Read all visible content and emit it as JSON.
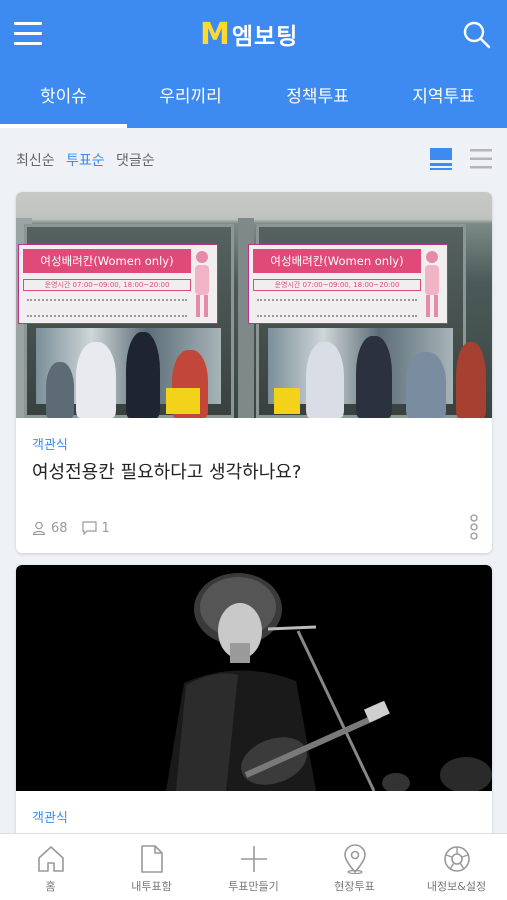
{
  "header": {
    "logo_letter": "M",
    "app_name": "엠보팅"
  },
  "tabs": [
    "핫이슈",
    "우리끼리",
    "정책투표",
    "지역투표"
  ],
  "sort_options": [
    "최신순",
    "투표순",
    "댓글순"
  ],
  "cards": [
    {
      "category": "객관식",
      "title": "여성전용칸 필요하다고 생각하나요?",
      "votes": "68",
      "comments": "1",
      "image": {
        "sign_title": "여성배려칸(Women only)",
        "sign_hours": "운영시간 07:00~09:00, 18:00~20:00"
      }
    },
    {
      "category": "객관식"
    }
  ],
  "bottom_nav": [
    "홈",
    "내투표함",
    "투표만들기",
    "현장투표",
    "내정보&설정"
  ],
  "colors": {
    "primary": "#3d8bf0",
    "logo_accent": "#ffd92e"
  }
}
